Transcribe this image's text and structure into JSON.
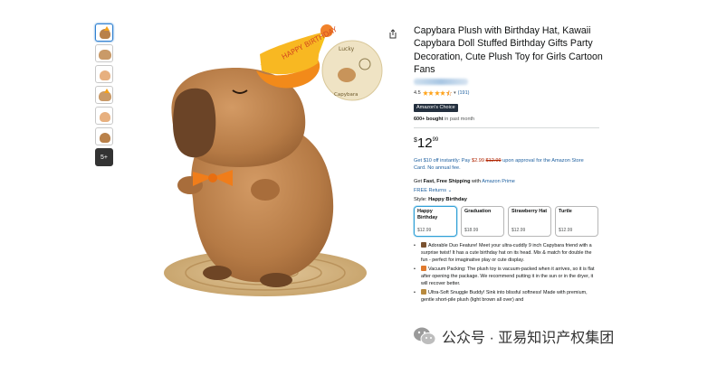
{
  "thumbnails": {
    "items": [
      "thumb-1",
      "thumb-2",
      "thumb-3",
      "thumb-4",
      "thumb-5",
      "thumb-6"
    ],
    "more_label": "5+"
  },
  "product": {
    "title": "Capybara Plush with Birthday Hat, Kawaii Capybara Doll Stuffed Birthday Gifts Party Decoration, Cute Plush Toy for Girls Cartoon Fans",
    "rating": "4.5",
    "rating_fraction": 0.9,
    "rating_count": "(191)",
    "badge": "Amazon's Choice",
    "bought_bold": "600+ bought",
    "bought_rest": " in past month",
    "price_symbol": "$",
    "price_whole": "12",
    "price_fraction": "99",
    "promo_1": "Get $10 off instantly: Pay ",
    "promo_new": "$2.99",
    "promo_old": "$12.99",
    "promo_2": " upon approval for the Amazon Store Card. No annual fee.",
    "ship_1": "Get ",
    "ship_bold": "Fast, Free Shipping",
    "ship_2": " with ",
    "ship_link": "Amazon Prime",
    "returns": "FREE Returns",
    "style_prefix": "Style: ",
    "style_value": "Happy Birthday"
  },
  "options": [
    {
      "name": "Happy Birthday",
      "price": "$12.99"
    },
    {
      "name": "Graduation",
      "price": "$18.99"
    },
    {
      "name": "Strawberry Hat",
      "price": "$12.99"
    },
    {
      "name": "Turtle",
      "price": "$12.99"
    }
  ],
  "bullets": [
    "Adorable Duo Feature! Meet your ultra-cuddly 9 inch Capybara friend with a surprise twist! It has a cute birthday hat on its head. Mix & match for double the fun - perfect for imaginative play or cute display.",
    "Vacuum Packing: The plush toy is vacuum-packed when it arrives, so it is flat after opening the package. We recommend putting it in the sun or in the dryer, it will recover better.",
    "Ultra-Soft Snuggle Buddy! Sink into blissful softness! Made with premium, gentle short-pile plush (light brown all over) and"
  ],
  "image_text": {
    "hat": "HAPPY BIRTHDAY",
    "tag_top": "Lucky",
    "tag_bottom": "Capybara"
  },
  "watermark": "公众号 · 亚易知识产权集团",
  "colors": {
    "link": "#2162a1",
    "selected_border": "#2f9fd6",
    "badge_bg": "#232f3e",
    "star": "#ffa41c",
    "plush": "#c08552"
  }
}
